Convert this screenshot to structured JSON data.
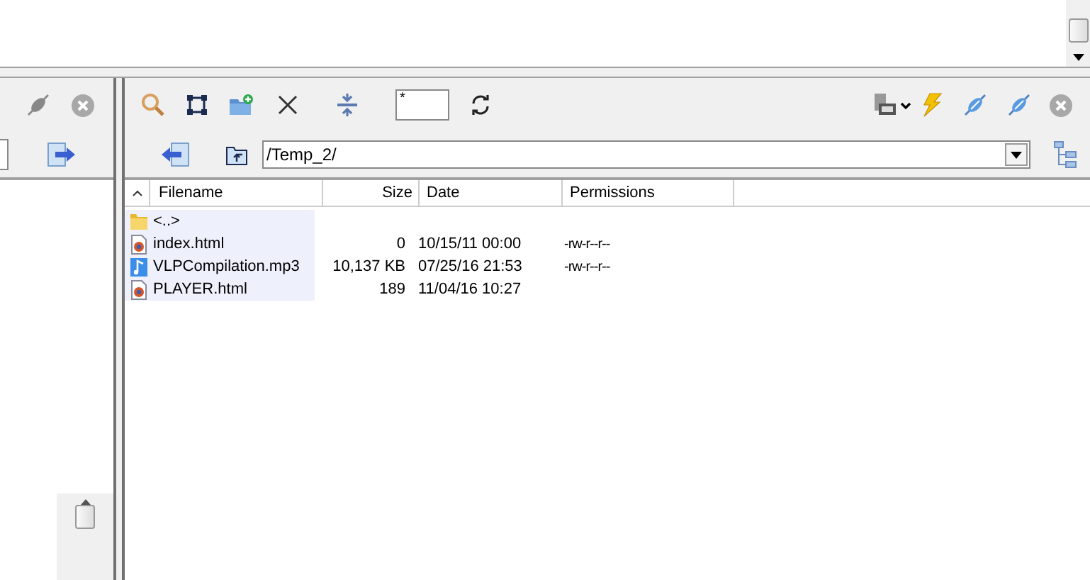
{
  "remote_pane": {
    "filter_field": {
      "value": "*"
    },
    "path_field": {
      "value": "/Temp_2/"
    },
    "columns": [
      "Filename",
      "Size",
      "Date",
      "Permissions"
    ],
    "rows": [
      {
        "kind": "folder",
        "name": "<..>",
        "size": "",
        "date": "",
        "permissions": ""
      },
      {
        "kind": "html",
        "name": "index.html",
        "size": "0",
        "date": "10/15/11  00:00",
        "permissions": "-rw-r--r--"
      },
      {
        "kind": "audio",
        "name": "VLPCompilation.mp3",
        "size": "10,137 KB",
        "date": "07/25/16  21:53",
        "permissions": "-rw-r--r--"
      },
      {
        "kind": "html",
        "name": "PLAYER.html",
        "size": "189",
        "date": "11/04/16  10:27",
        "permissions": ""
      }
    ]
  }
}
